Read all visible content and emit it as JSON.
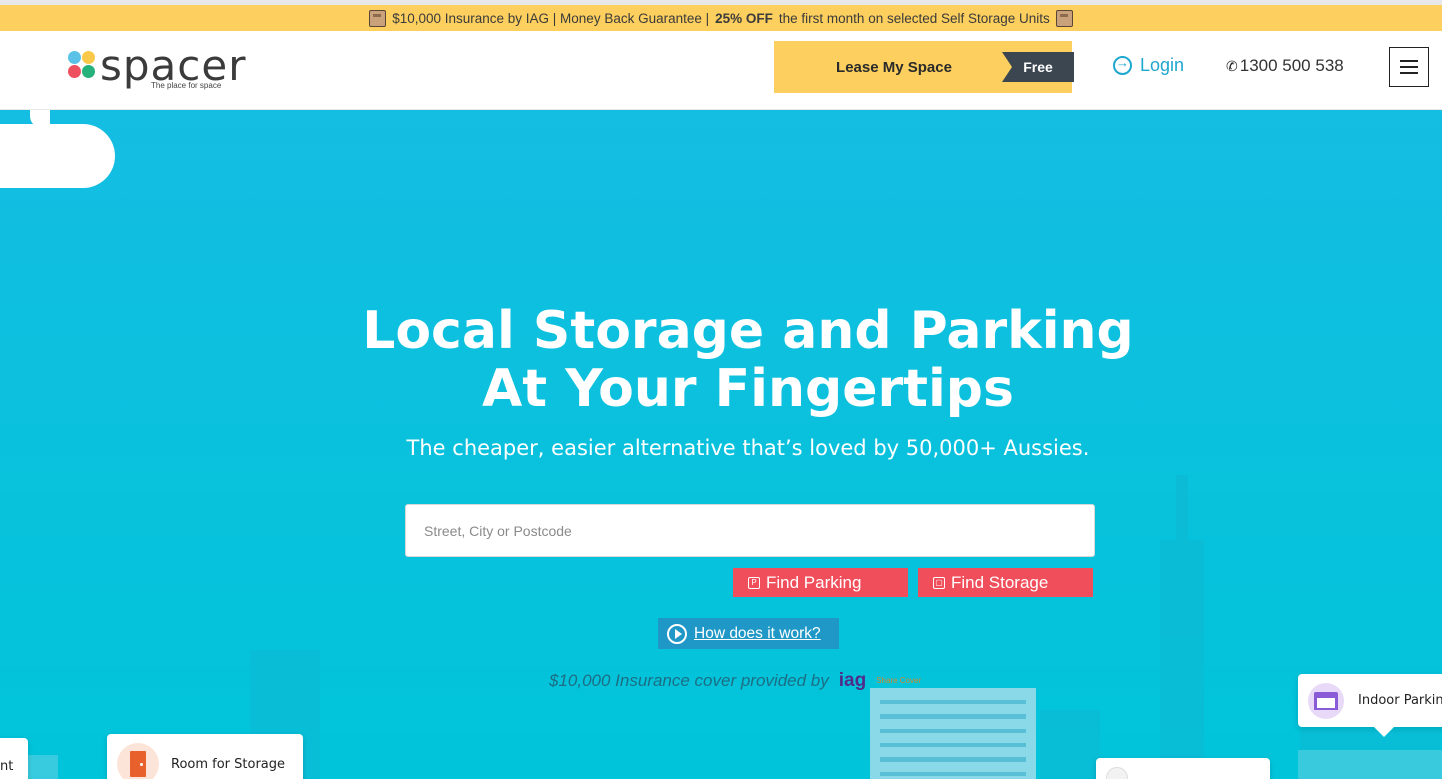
{
  "promo": {
    "text_before": "$10,000 Insurance by IAG | Money Back Guarantee |",
    "text_bold": "25% OFF",
    "text_after": "the first month on selected Self Storage Units"
  },
  "header": {
    "logo_text": "spacer",
    "logo_tagline": "The place for space",
    "lease_label": "Lease My Space",
    "lease_badge": "Free",
    "login_label": "Login",
    "phone": "1300 500 538"
  },
  "hero": {
    "headline_line1": "Local Storage and Parking",
    "headline_line2": "At Your Fingertips",
    "subhead": "The cheaper, easier alternative that’s loved by 50,000+ Aussies.",
    "search_placeholder": "Street, City or Postcode",
    "find_parking_label": "Find Parking",
    "find_storage_label": "Find Storage",
    "how_label": "How does it work?",
    "insurance_text": "$10,000 Insurance cover provided by",
    "iag_logo": "iag",
    "sharecover_logo": "Share Cover"
  },
  "cards": {
    "room_label": "Room for Storage",
    "indoor_label": "Indoor Parking",
    "partial_label": "nt"
  },
  "colors": {
    "promo_bg": "#fccf5e",
    "hero_bg": "#08c2dc",
    "find_button": "#f04e5a",
    "how_button": "#1f98c7",
    "login": "#1ea7cf"
  },
  "icons": [
    "box-icon",
    "login-icon",
    "phone-icon",
    "menu-icon",
    "parking-icon",
    "storage-box-icon",
    "play-icon",
    "door-icon",
    "garage-icon"
  ]
}
